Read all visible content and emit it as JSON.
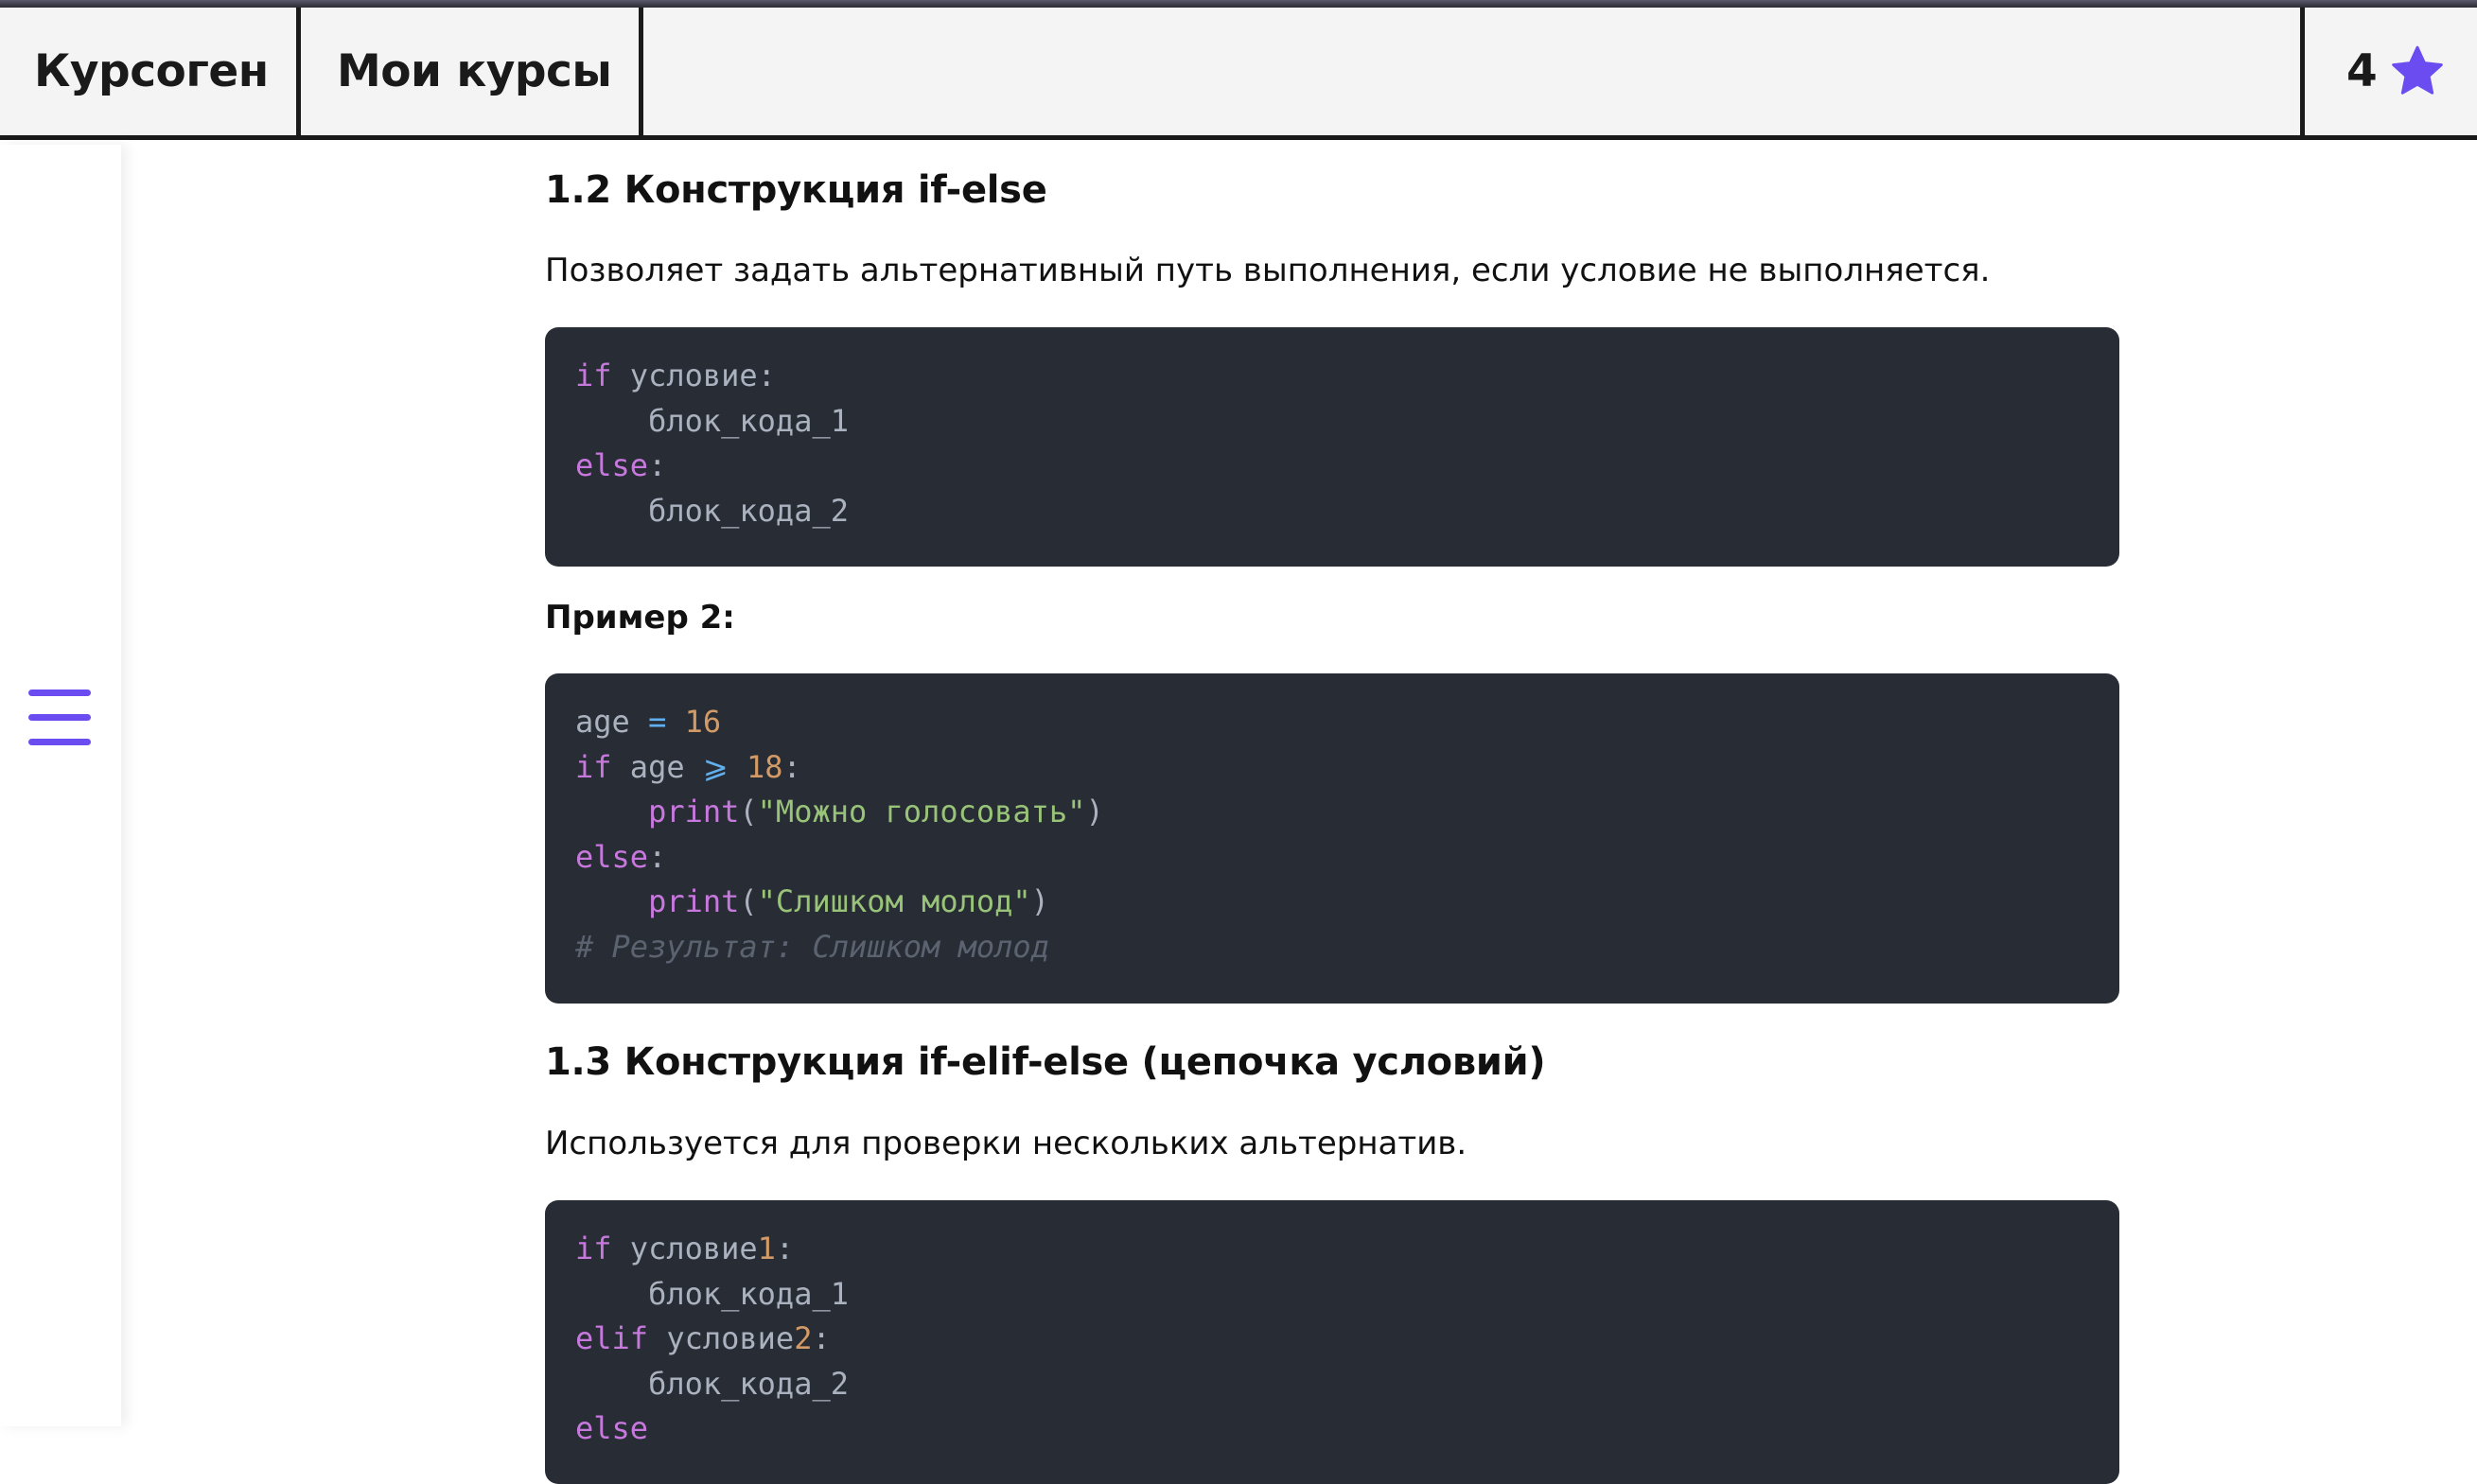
{
  "header": {
    "brand": "Курсоген",
    "my_courses": "Мои курсы",
    "stars_count": "4",
    "star_icon": "star-icon",
    "accent_color": "#6a4cf0"
  },
  "sidebar": {
    "menu_icon": "hamburger-menu-icon"
  },
  "content": {
    "section_12": {
      "title": "1.2 Конструкция if-else",
      "description": "Позволяет задать альтернативный путь выполнения, если условие не выполняется.",
      "code": {
        "l1_kw": "if",
        "l1_rest": " условие:",
        "l2": "    блок_кода_1",
        "l3_kw": "else",
        "l3_rest": ":",
        "l4": "    блок_кода_2"
      }
    },
    "example_2": {
      "label": "Пример 2:",
      "code": {
        "l1_var": "age",
        "l1_op": "=",
        "l1_num": "16",
        "l2_kw": "if",
        "l2_var": " age ",
        "l2_op": "⩾",
        "l2_num": "18",
        "l2_colon": ":",
        "l3_indent": "    ",
        "l3_fn": "print",
        "l3_open": "(",
        "l3_str": "\"Можно голосовать\"",
        "l3_close": ")",
        "l4_kw": "else",
        "l4_colon": ":",
        "l5_indent": "    ",
        "l5_fn": "print",
        "l5_open": "(",
        "l5_str": "\"Слишком молод\"",
        "l5_close": ")",
        "l6_comment": "# Результат: Слишком молод"
      }
    },
    "section_13": {
      "title": "1.3 Конструкция if-elif-else (цепочка условий)",
      "description": "Используется для проверки нескольких альтернатив.",
      "code": {
        "l1_kw": "if",
        "l1_text": " условие",
        "l1_num": "1",
        "l1_colon": ":",
        "l2": "    блок_кода_1",
        "l3_kw": "elif",
        "l3_text": " условие",
        "l3_num": "2",
        "l3_colon": ":",
        "l4": "    блок_кода_2",
        "l5_kw": "else"
      }
    }
  }
}
